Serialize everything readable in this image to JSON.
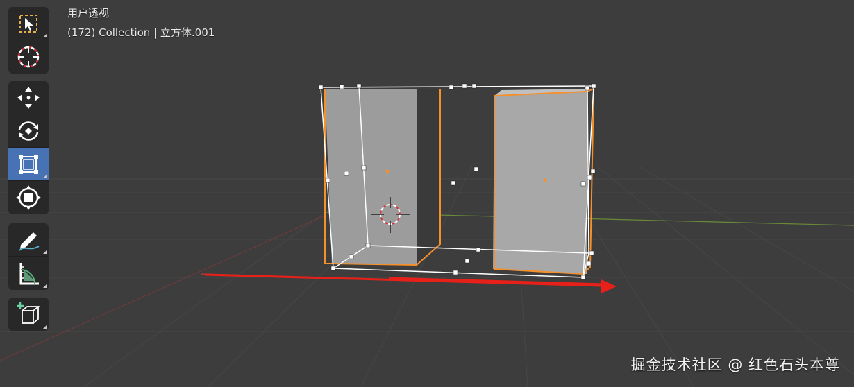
{
  "viewport": {
    "view_name": "用户透视",
    "object_info": "(172) Collection | 立方体.001"
  },
  "toolbar": {
    "groups": [
      [
        "select-box-tool",
        "cursor-tool"
      ],
      [
        "move-tool",
        "rotate-tool",
        "scale-tool",
        "transform-tool"
      ],
      [
        "annotate-tool",
        "measure-tool"
      ],
      [
        "add-cube-tool"
      ]
    ],
    "active_tool": "scale-tool"
  },
  "colors": {
    "background": "#3d3d3d",
    "grid": "#4a4a4a",
    "x_axis": "#a83c3c",
    "y_axis": "#6a8a3a",
    "selection_outline": "#f5902a",
    "active_tool": "#4772b3",
    "arrow": "#e8201a"
  },
  "watermark": "掘金技术社区 @ 红色石头本尊"
}
